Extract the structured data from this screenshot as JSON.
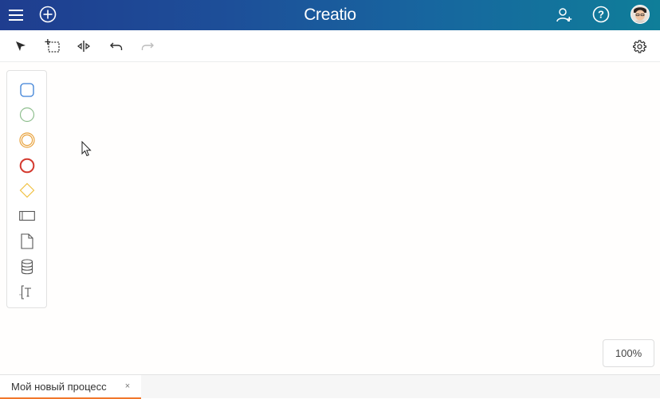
{
  "header": {
    "logo_text": "Creatio",
    "icons": [
      "menu-icon",
      "add-circle-icon",
      "add-user-icon",
      "help-icon",
      "avatar"
    ]
  },
  "toolbar": {
    "tools": [
      "select-pointer-icon",
      "area-select-icon",
      "distribute-space-icon",
      "undo-icon",
      "redo-icon"
    ],
    "right_tool": "settings-gear-icon"
  },
  "palette": {
    "items": [
      "task-rounded-square-icon",
      "start-event-circle-icon",
      "intermediate-event-double-circle-icon",
      "end-event-circle-icon",
      "gateway-diamond-icon",
      "lane-pool-icon",
      "data-object-document-icon",
      "data-store-cylinder-icon",
      "text-annotation-icon"
    ]
  },
  "zoom": {
    "value": "100%"
  },
  "tabs": [
    {
      "label": "Мой новый процесс",
      "close": "×"
    }
  ],
  "colors": {
    "header_start": "#1f3d8f",
    "header_end": "#0f7e99",
    "task_blue": "#3a7fd6",
    "start_green": "#8fbf8f",
    "intermediate_orange": "#e8a13a",
    "end_red": "#d43a2f",
    "gateway_yellow": "#f0c244",
    "tab_accent": "#f1772b"
  }
}
